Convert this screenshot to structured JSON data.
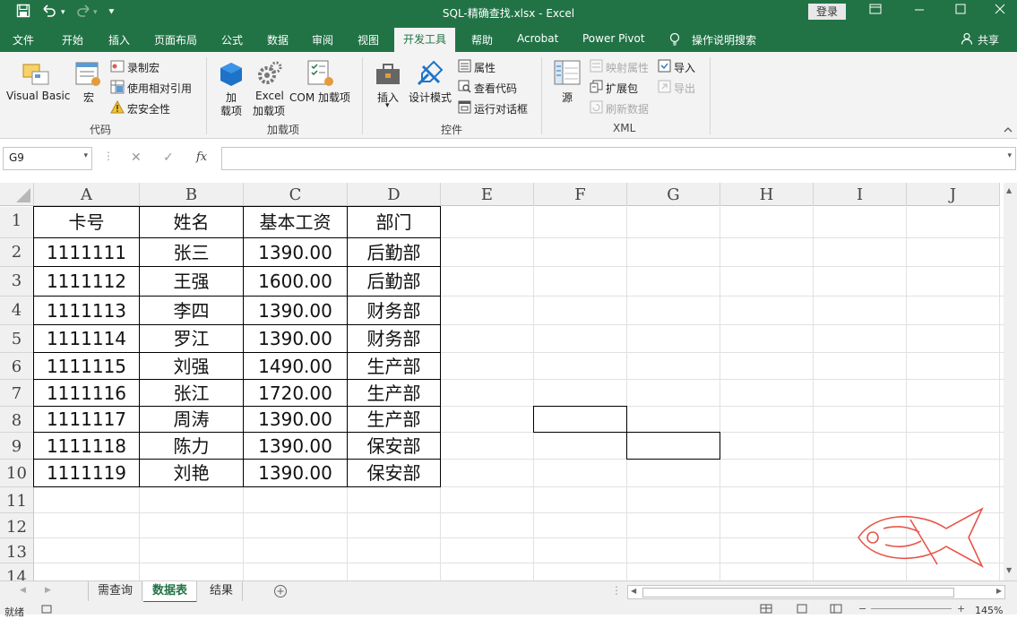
{
  "window": {
    "title": "SQL-精确查找.xlsx  -  Excel",
    "login_label": "登录",
    "share_label": "共享"
  },
  "ribbon_tabs": [
    "文件",
    "开始",
    "插入",
    "页面布局",
    "公式",
    "数据",
    "审阅",
    "视图",
    "开发工具",
    "帮助",
    "Acrobat",
    "Power Pivot",
    "操作说明搜索"
  ],
  "active_tab": "开发工具",
  "ribbon": {
    "code": {
      "visual_basic": "Visual Basic",
      "macro": "宏",
      "record_macro": "录制宏",
      "relative_ref": "使用相对引用",
      "macro_security": "宏安全性",
      "group": "代码"
    },
    "addins": {
      "addin_line1": "加",
      "addin_line2": "载项",
      "excel_line1": "Excel",
      "excel_line2": "加载项",
      "com_addin": "COM 加载项",
      "group": "加载项"
    },
    "controls": {
      "insert": "插入",
      "design_mode": "设计模式",
      "properties": "属性",
      "view_code": "查看代码",
      "run_dialog": "运行对话框",
      "group": "控件"
    },
    "xml": {
      "source": "源",
      "map_props": "映射属性",
      "expansion": "扩展包",
      "refresh": "刷新数据",
      "import": "导入",
      "export": "导出",
      "group": "XML"
    }
  },
  "formula_bar": {
    "name_box": "G9",
    "cancel_icon": "✕",
    "enter_icon": "✓",
    "fx": "fx",
    "formula": ""
  },
  "columns": [
    "A",
    "B",
    "C",
    "D",
    "E",
    "F",
    "G",
    "H",
    "I",
    "J"
  ],
  "rows": [
    "1",
    "2",
    "3",
    "4",
    "5",
    "6",
    "7",
    "8",
    "9",
    "10",
    "11",
    "12",
    "13",
    "14"
  ],
  "table": {
    "headers": [
      "卡号",
      "姓名",
      "基本工资",
      "部门"
    ],
    "data": [
      [
        "1111111",
        "张三",
        "1390.00",
        "后勤部"
      ],
      [
        "1111112",
        "王强",
        "1600.00",
        "后勤部"
      ],
      [
        "1111113",
        "李四",
        "1390.00",
        "财务部"
      ],
      [
        "1111114",
        "罗江",
        "1390.00",
        "财务部"
      ],
      [
        "1111115",
        "刘强",
        "1490.00",
        "生产部"
      ],
      [
        "1111116",
        "张江",
        "1720.00",
        "生产部"
      ],
      [
        "1111117",
        "周涛",
        "1390.00",
        "生产部"
      ],
      [
        "1111118",
        "陈力",
        "1390.00",
        "保安部"
      ],
      [
        "1111119",
        "刘艳",
        "1390.00",
        "保安部"
      ]
    ]
  },
  "sheets": [
    "需查询",
    "数据表",
    "结果"
  ],
  "active_sheet": "数据表",
  "status": {
    "ready": "就绪",
    "zoom": "145%"
  },
  "colors": {
    "excel_green": "#217346",
    "watermark": "#e8554a"
  }
}
